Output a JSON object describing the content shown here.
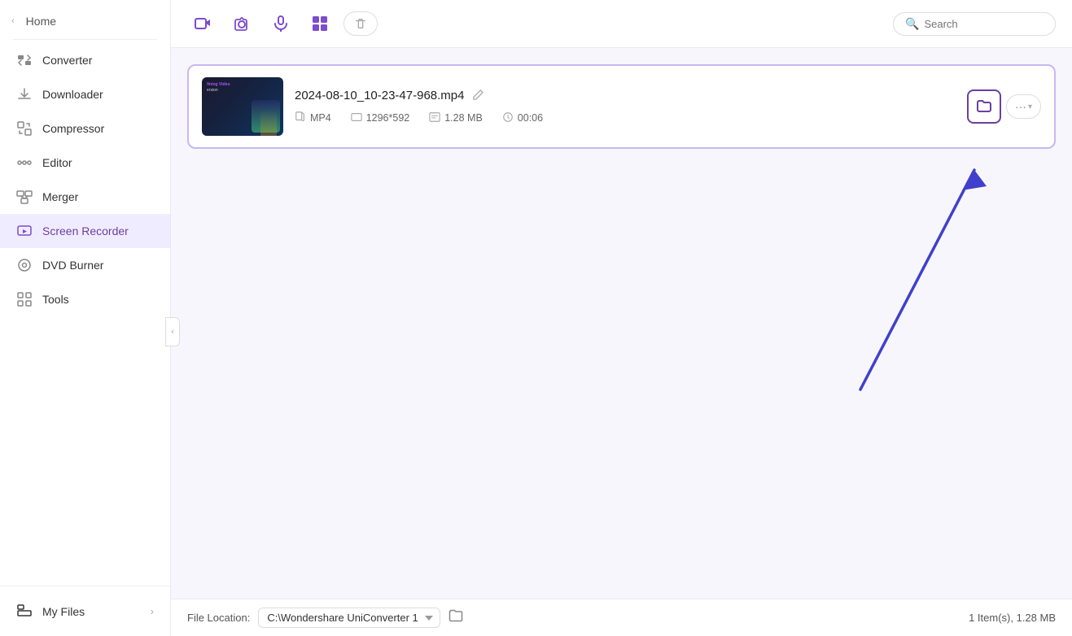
{
  "sidebar": {
    "home_label": "Home",
    "items": [
      {
        "id": "converter",
        "label": "Converter",
        "icon": "converter"
      },
      {
        "id": "downloader",
        "label": "Downloader",
        "icon": "downloader"
      },
      {
        "id": "compressor",
        "label": "Compressor",
        "icon": "compressor"
      },
      {
        "id": "editor",
        "label": "Editor",
        "icon": "editor"
      },
      {
        "id": "merger",
        "label": "Merger",
        "icon": "merger"
      },
      {
        "id": "screen-recorder",
        "label": "Screen Recorder",
        "icon": "screen-recorder"
      },
      {
        "id": "dvd-burner",
        "label": "DVD Burner",
        "icon": "dvd-burner"
      },
      {
        "id": "tools",
        "label": "Tools",
        "icon": "tools"
      }
    ],
    "active_item": "screen-recorder",
    "my_files_label": "My Files"
  },
  "toolbar": {
    "search_placeholder": "Search",
    "delete_tooltip": "Delete"
  },
  "file_card": {
    "filename": "2024-08-10_10-23-47-968.mp4",
    "format": "MP4",
    "resolution": "1296*592",
    "size": "1.28 MB",
    "duration": "00:06",
    "thumbnail_alt": "Video thumbnail"
  },
  "annotation_arrow": {
    "visible": true,
    "label": "folder button"
  },
  "footer": {
    "file_location_label": "File Location:",
    "location_value": "C:\\Wondershare UniConverter 1",
    "summary": "1 Item(s), 1.28 MB"
  }
}
